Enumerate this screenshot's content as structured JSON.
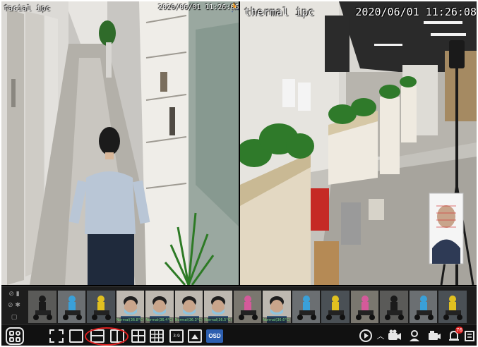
{
  "panes": {
    "left": {
      "title": "facial ipc",
      "timestamp": "2020/06/01 11:26:06"
    },
    "right": {
      "title": "thermal ipc",
      "timestamp": "2020/06/01 11:26:08"
    }
  },
  "thumbnail_strip": {
    "thumbs": [
      {
        "kind": "scooter",
        "caption": ""
      },
      {
        "kind": "scooter",
        "caption": ""
      },
      {
        "kind": "scooter",
        "caption": ""
      },
      {
        "kind": "face",
        "caption": "Normal(36.8°C)"
      },
      {
        "kind": "face",
        "caption": "Normal(36.4°C)"
      },
      {
        "kind": "face",
        "caption": "Normal(36.3°C)"
      },
      {
        "kind": "face",
        "caption": "Normal(36.5°C)"
      },
      {
        "kind": "scooter",
        "caption": ""
      },
      {
        "kind": "face",
        "caption": "Normal(36.6°C)"
      },
      {
        "kind": "scooter",
        "caption": ""
      },
      {
        "kind": "scooter",
        "caption": ""
      },
      {
        "kind": "scooter",
        "caption": ""
      },
      {
        "kind": "scooter",
        "caption": ""
      },
      {
        "kind": "scooter",
        "caption": ""
      },
      {
        "kind": "scooter",
        "caption": ""
      }
    ]
  },
  "toolbar": {
    "osd_label": "OSD",
    "layout_9_label": "3:9",
    "alarm_count": "76",
    "icons": [
      "menu-icon",
      "fullscreen-icon",
      "single-view-icon",
      "layout-split-h-icon",
      "layout-split-v-icon",
      "layout-quad-icon",
      "layout-nine-icon",
      "layout-custom-icon",
      "layout-picture-icon",
      "osd-icon",
      "play-icon",
      "chevron-up-icon",
      "camera-icon",
      "user-capture-icon",
      "record-icon",
      "alarm-icon",
      "menu-list-icon"
    ]
  }
}
